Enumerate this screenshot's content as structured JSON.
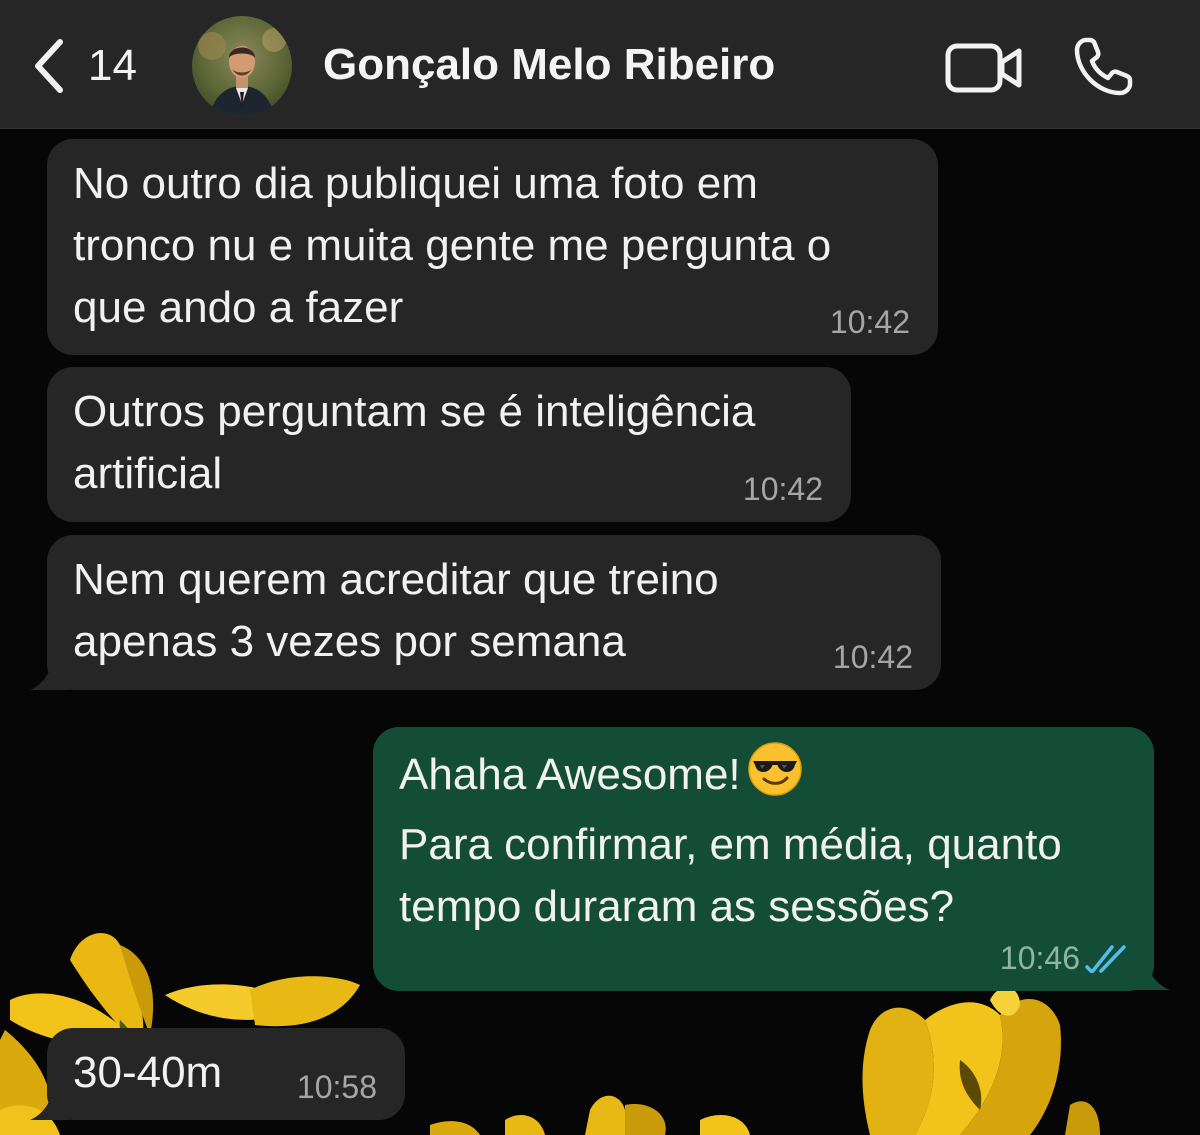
{
  "header": {
    "back_count": "14",
    "contact_name": "Gonçalo Melo Ribeiro",
    "icons": {
      "back": "chevron-left-icon",
      "video": "video-camera-icon",
      "call": "phone-icon"
    }
  },
  "messages": [
    {
      "direction": "incoming",
      "text": "No outro dia publiquei uma foto em\ntronco nu e muita gente me pergunta o\nque ando a fazer",
      "time": "10:42"
    },
    {
      "direction": "incoming",
      "text": "Outros perguntam se é inteligência\nartificial",
      "time": "10:42"
    },
    {
      "direction": "incoming",
      "text": "Nem querem acreditar que treino\napenas 3 vezes por semana",
      "time": "10:42"
    },
    {
      "direction": "outgoing",
      "text_line1": "Ahaha Awesome!",
      "emoji": "smiling-face-with-sunglasses",
      "text_rest": "Para confirmar, em média, quanto\ntempo duraram as sessões?",
      "time": "10:46",
      "status": "read"
    },
    {
      "direction": "incoming",
      "text": "30-40m",
      "time": "10:58"
    }
  ],
  "colors": {
    "header_bg": "#262626",
    "incoming_bubble": "#262626",
    "outgoing_bubble": "#144d37",
    "read_ticks": "#53bdeb",
    "flower": "#f2c31a"
  }
}
